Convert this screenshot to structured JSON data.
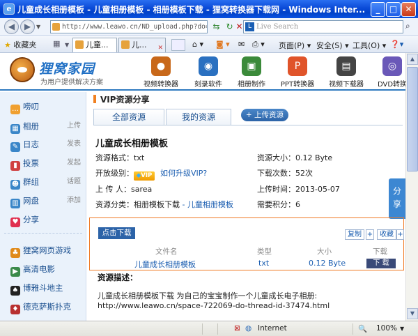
{
  "window": {
    "title": "儿童成长相册模板 - 儿童相册模板 - 相册模板下载 - 狸窝转换器下载网 - Windows Inter...",
    "icon": "ie-icon"
  },
  "address_bar": {
    "url": "http://www.leawo.cn/ND_upload.php?do=i",
    "search_placeholder": "Live Search"
  },
  "toolbar": {
    "favorites_label": "收藏夹",
    "tabs": [
      {
        "label": "儿童..."
      },
      {
        "label": "儿..."
      }
    ],
    "page_menu": "页面(P)",
    "safety_menu": "安全(S)",
    "tools_menu": "工具(O)"
  },
  "site": {
    "logo_text": "狸窝家园",
    "logo_sub": "为用户提供解决方案",
    "nav": [
      {
        "label": "视频转换器",
        "color": "#c8681a",
        "icon": "●"
      },
      {
        "label": "刻录软件",
        "color": "#2a70c0",
        "icon": "◉"
      },
      {
        "label": "相册制作",
        "color": "#3b8a3a",
        "icon": "▣"
      },
      {
        "label": "PPT转换器",
        "color": "#e0542a",
        "icon": "P"
      },
      {
        "label": "视频下载器",
        "color": "#444444",
        "icon": "▤"
      },
      {
        "label": "DVD转换",
        "color": "#6a58b8",
        "icon": "◎"
      }
    ]
  },
  "sidebar": {
    "items": [
      {
        "label": "唠叨",
        "extra": "",
        "color": "#f0a030",
        "icon": "💬"
      },
      {
        "label": "相册",
        "extra": "上传",
        "color": "#3a86c8",
        "icon": "▦"
      },
      {
        "label": "日志",
        "extra": "发表",
        "color": "#3a86c8",
        "icon": "✎"
      },
      {
        "label": "投票",
        "extra": "发起",
        "color": "#d04040",
        "icon": "▮"
      },
      {
        "label": "群组",
        "extra": "话题",
        "color": "#3a86c8",
        "icon": "☻"
      },
      {
        "label": "网盘",
        "extra": "添加",
        "color": "#3a86c8",
        "icon": "▥"
      },
      {
        "label": "分享",
        "extra": "",
        "color": "#e03050",
        "icon": "♥"
      },
      {
        "label": "狸窝网页游戏",
        "extra": "",
        "color": "#e08a1a",
        "icon": "♣"
      },
      {
        "label": "高清电影",
        "extra": "",
        "color": "#3a8a4a",
        "icon": "▶"
      },
      {
        "label": "博雅斗地主",
        "extra": "",
        "color": "#222222",
        "icon": "♠"
      },
      {
        "label": "德克萨斯扑克",
        "extra": "",
        "color": "#b83030",
        "icon": "♦"
      }
    ]
  },
  "main": {
    "section_title": "VIP资源分享",
    "tabs": [
      {
        "label": "全部资源"
      },
      {
        "label": "我的资源"
      }
    ],
    "upload_button": "+ 上传资源",
    "resource": {
      "title": "儿童成长相册模板",
      "format_label": "资源格式：",
      "format_value": "txt",
      "size_label": "资源大小：",
      "size_value": "0.12 Byte",
      "level_label": "开放级别：",
      "vip_badge": "VIP",
      "upgrade_link": "如何升级VIP?",
      "downloads_label": "下载次数：",
      "downloads_value": "52次",
      "uploader_label": "上 传 人：",
      "uploader_value": "sarea",
      "upload_time_label": "上传时间：",
      "upload_time_value": "2013-05-07",
      "category_label": "资源分类：",
      "category_value": "相册模板下载",
      "category_link": "- 儿童相册模板",
      "points_label": "需要积分：",
      "points_value": "6"
    },
    "share_tab": [
      "分",
      "享"
    ],
    "download_box": {
      "button": "点击下载",
      "copy": "复制",
      "plus": "+",
      "favorite": "收藏",
      "headers": [
        "文件名",
        "类型",
        "大小",
        "下载"
      ],
      "row": {
        "name": "儿童成长相册模板",
        "type": "txt",
        "size": "0.12 Byte",
        "action": "下 载"
      }
    },
    "description": {
      "title": "资源描述：",
      "text": "儿童成长相册模板下载 为自己的宝宝制作一个儿童成长电子相册:",
      "link": "http://www.leawo.cn/space-722069-do-thread-id-37474.html"
    }
  },
  "status_bar": {
    "zone": "Internet",
    "zoom": "100%"
  }
}
